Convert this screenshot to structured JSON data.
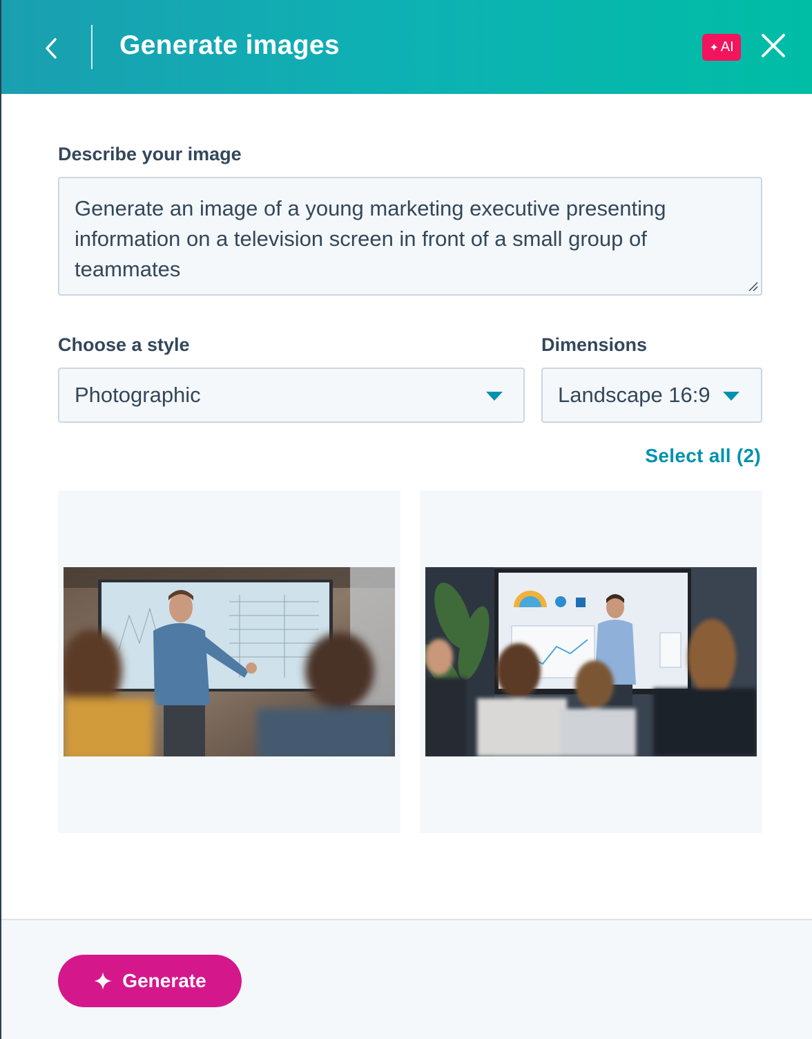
{
  "header": {
    "title": "Generate images",
    "ai_badge": "AI",
    "back_icon": "chevron-left-icon",
    "close_icon": "close-icon",
    "gradient_start": "#1a9fb0",
    "gradient_end": "#00bda5"
  },
  "form": {
    "description_label": "Describe your image",
    "description_value": "Generate an image of a young marketing executive presenting information on a television screen in front of a small group of teammates",
    "style_label": "Choose a style",
    "style_value": "Photographic",
    "dimensions_label": "Dimensions",
    "dimensions_value": "Landscape 16:9"
  },
  "results": {
    "select_all_label": "Select all (2)",
    "images": [
      {
        "name": "generated-image-1"
      },
      {
        "name": "generated-image-2"
      }
    ]
  },
  "footer": {
    "generate_label": "Generate",
    "generate_color": "#d5178c"
  },
  "colors": {
    "accent": "#0091ae",
    "ai_badge": "#f2145d",
    "text": "#33475b"
  }
}
